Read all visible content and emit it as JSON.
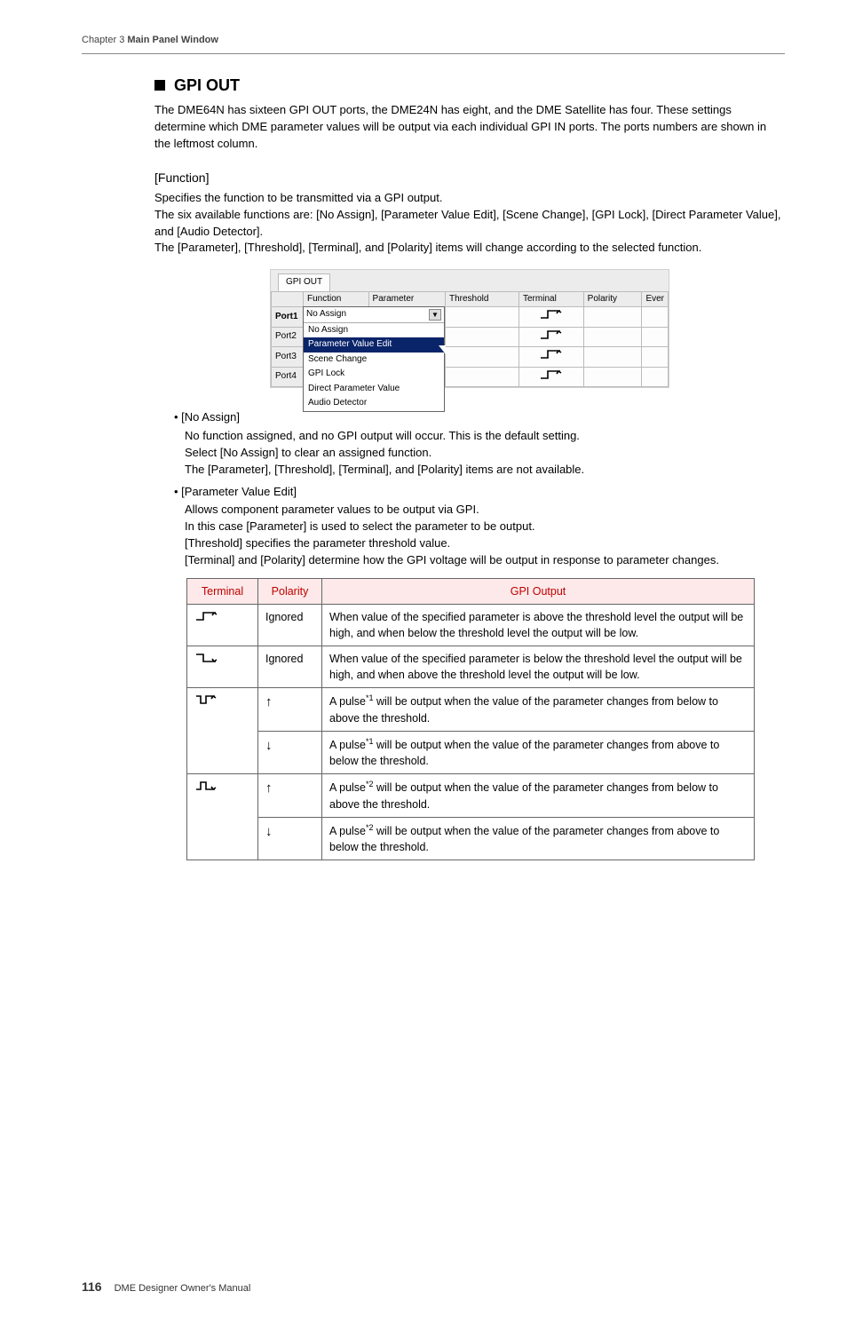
{
  "chapter_header": {
    "prefix": "Chapter 3  ",
    "title": "Main Panel Window"
  },
  "h_gpi_out": "GPI OUT",
  "intro": "The DME64N has sixteen GPI OUT ports, the DME24N has eight, and the DME Satellite has four. These settings determine which DME parameter values will be output via each individual GPI IN ports. The ports numbers are shown in the leftmost column.",
  "function_head": "[Function]",
  "function_p1": "Specifies the function to be transmitted via a GPI output.",
  "function_p2": "The six available functions are: [No Assign], [Parameter Value Edit], [Scene Change], [GPI Lock], [Direct Parameter Value], and [Audio Detector].",
  "function_p3": "The [Parameter], [Threshold], [Terminal], and [Polarity] items will change according to the selected function.",
  "screenshot": {
    "tab": "GPI OUT",
    "headers": [
      "",
      "Function",
      "Parameter",
      "Threshold",
      "Terminal",
      "Polarity",
      "Ever"
    ],
    "ports": [
      "Port1",
      "Port2",
      "Port3",
      "Port4"
    ],
    "selected": "No Assign",
    "options": [
      "No Assign",
      "Parameter Value Edit",
      "Scene Change",
      "GPI Lock",
      "Direct Parameter Value",
      "Audio Detector"
    ]
  },
  "no_assign": {
    "title": "[No Assign]",
    "l1": "No function assigned, and no GPI output will occur. This is the default setting.",
    "l2": "Select [No Assign] to clear an assigned function.",
    "l3": "The [Parameter], [Threshold], [Terminal], and [Polarity] items are not available."
  },
  "pve": {
    "title": "[Parameter Value Edit]",
    "l1": "Allows component parameter values to be output via GPI.",
    "l2": "In this case [Parameter] is used to select the parameter to be output.",
    "l3": "[Threshold] specifies the parameter threshold value.",
    "l4": "[Terminal] and [Polarity] determine how the GPI voltage will be output in response to parameter changes."
  },
  "table": {
    "headers": {
      "terminal": "Terminal",
      "polarity": "Polarity",
      "output": "GPI Output"
    },
    "rows": [
      {
        "polarity_text": "Ignored",
        "out": "When value of the specified parameter is above the threshold level the output will be high, and when below the threshold level the output will be low."
      },
      {
        "polarity_text": "Ignored",
        "out": "When value of the specified parameter is below the threshold level the output will be high, and when above the threshold level the output will be low."
      },
      {
        "sup": "*1",
        "out_a": "A pulse",
        "out_b": " will be output when the value of the parameter changes from below to above the threshold."
      },
      {
        "sup": "*1",
        "out_a": "A pulse",
        "out_b": " will be output when the value of the parameter changes from above to below the threshold."
      },
      {
        "sup": "*2",
        "out_a": "A pulse",
        "out_b": " will be output when the value of the parameter changes from below to above the threshold."
      },
      {
        "sup": "*2",
        "out_a": "A pulse",
        "out_b": " will be output when the value of the parameter changes from above to below the threshold."
      }
    ]
  },
  "footer": {
    "page": "116",
    "text": "DME Designer Owner's Manual"
  }
}
